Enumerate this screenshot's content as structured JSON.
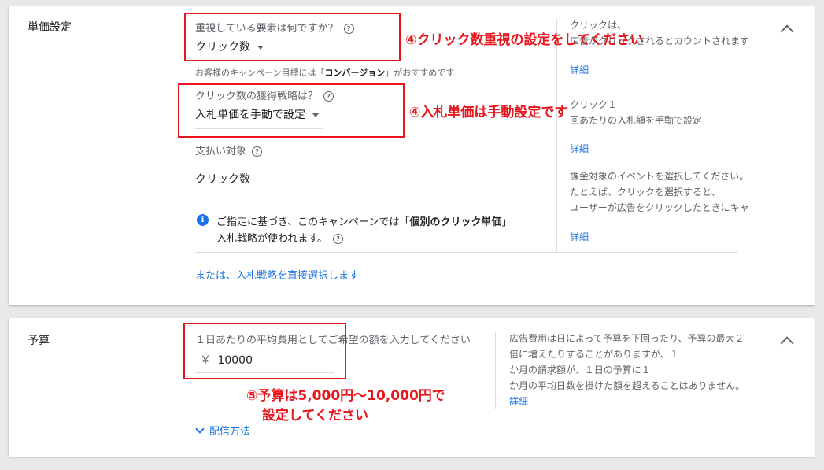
{
  "bid": {
    "section_title": "単価設定",
    "focus_label": "重視している要素は何ですか？",
    "focus_value": "クリック数",
    "focus_hint_prefix": "お客様のキャンペーン目標には「",
    "focus_hint_bold": "コンバージョン",
    "focus_hint_suffix": "」がおすすめです",
    "strategy_label": "クリック数の獲得戦略は？",
    "strategy_value": "入札単価を手動で設定",
    "pay_label": "支払い対象",
    "pay_value": "クリック数",
    "info_line1_prefix": "ご指定に基づき、このキャンペーンでは「",
    "info_line1_bold": "個別のクリック単価",
    "info_line1_suffix": "」",
    "info_line2": "入札戦略が使われます。",
    "direct_link": "または、入札戦略を直接選択します",
    "right": {
      "focus_desc_1": "クリックは、",
      "focus_desc_2": "広告がクリックされるとカウントされます",
      "focus_link": "詳細",
      "strategy_desc_1": "クリック１",
      "strategy_desc_2": "回あたりの入札額を手動で設定",
      "strategy_link": "詳細",
      "pay_desc_1": "課金対象のイベントを選択してください。",
      "pay_desc_2": "たとえば、クリックを選択すると、",
      "pay_desc_3": "ユーザーが広告をクリックしたときにキャ",
      "pay_link": "詳細"
    }
  },
  "budget": {
    "section_title": "予算",
    "input_label": "１日あたりの平均費用としてご希望の額を入力してください",
    "currency": "￥",
    "amount": "10000",
    "delivery_link": "配信方法",
    "right": {
      "line1": "広告費用は日によって予算を下回ったり、予算の最大２",
      "line2": "倍に増えたりすることがありますが、１",
      "line3": "か月の請求額が、１日の予算に１",
      "line4": "か月の平均日数を掛けた額を超えることはありません。",
      "link": "詳細"
    }
  },
  "annotations": {
    "a1": "④クリック数重視の設定をしてください",
    "a2": "④入札単価は手動設定です",
    "a3_line1": "⑤予算は5,000円〜10,000円で",
    "a3_line2": "設定してください"
  },
  "colors": {
    "annotation_red": "#e8141b",
    "link_blue": "#1a73e8"
  }
}
